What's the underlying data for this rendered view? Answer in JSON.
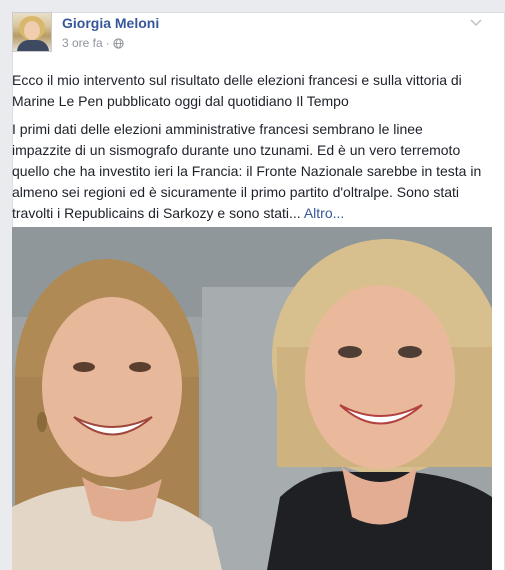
{
  "post": {
    "author": "Giorgia Meloni",
    "timestamp": "3 ore fa",
    "separator": "·",
    "audience_icon": "globe-icon",
    "menu_icon": "chevron-down-icon",
    "headline": "Ecco il mio intervento sul risultato delle elezioni francesi e sulla vittoria di Marine Le Pen pubblicato oggi dal quotidiano Il Tempo",
    "body": "I primi dati delle elezioni amministrative francesi sembrano le linee impazzite di un sismografo durante uno tzunami. Ed è un vero terremoto quello che ha investito ieri la Francia: il Fronte Nazionale sarebbe in testa in almeno sei regioni ed è sicuramente il primo partito d'oltralpe. Sono stati travolti i Republicains di Sarkozy e sono stati...",
    "see_more": "Altro...",
    "photo": "selfie-photo"
  },
  "colors": {
    "link": "#365899",
    "meta": "#90949c",
    "text": "#1d2129",
    "background": "#e9ebee"
  }
}
